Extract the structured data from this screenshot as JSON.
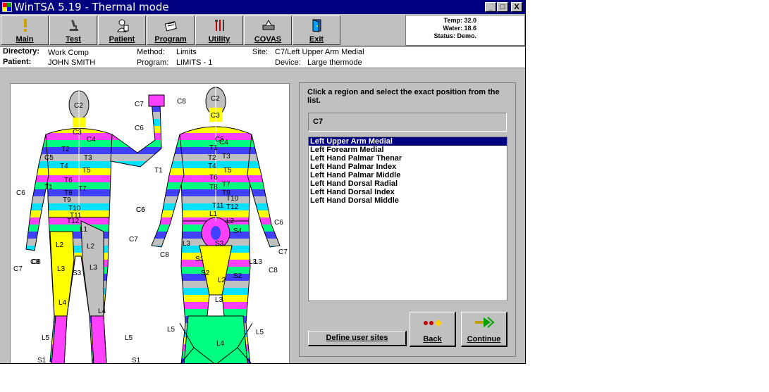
{
  "window": {
    "title": "WinTSA 5.19 - Thermal mode",
    "min": "_",
    "max": "□",
    "close": "X"
  },
  "toolbar": [
    {
      "label": "Main",
      "icon": "exclamation-icon"
    },
    {
      "label": "Test",
      "icon": "microscope-icon"
    },
    {
      "label": "Patient",
      "icon": "patient-icon"
    },
    {
      "label": "Program",
      "icon": "program-icon"
    },
    {
      "label": "Utility",
      "icon": "tools-icon"
    },
    {
      "label": "COVAS",
      "icon": "covas-icon"
    },
    {
      "label": "Exit",
      "icon": "exit-door-icon"
    }
  ],
  "status": {
    "temp": "Temp: 32.0",
    "water": "Water: 18.6",
    "state": "Status: Demo."
  },
  "info": {
    "directory_label": "Directory:",
    "directory": "Work Comp",
    "patient_label": "Patient:",
    "patient": "JOHN SMITH",
    "method_label": "Method:",
    "method": "Limits",
    "program_label": "Program:",
    "program": "LIMITS - 1",
    "site_label": "Site:",
    "site": "C7/Left Upper Arm Medial",
    "device_label": "Device:",
    "device": "Large thermode"
  },
  "panel": {
    "instruction": "Click a region and select the exact position from the list.",
    "selected": "C7",
    "items": [
      "Left Upper Arm Medial",
      "Left Forearm Medial",
      "Left Hand Palmar Thenar",
      "Left Hand Palmar Index",
      "Left Hand Palmar Middle",
      "Left Hand Dorsal Radial",
      "Left Hand Dorsal Index",
      "Left Hand Dorsal Middle"
    ],
    "define_label": "Define user sites",
    "back_label": "Back",
    "continue_label": "Continue"
  },
  "map_labels": {
    "front": [
      "C2",
      "C3",
      "C4",
      "T2",
      "T3",
      "T4",
      "T5",
      "T6",
      "T7",
      "T8",
      "T9",
      "T10",
      "T11",
      "T12",
      "L1",
      "L2",
      "L2",
      "L3",
      "L3",
      "S3",
      "L4",
      "L4",
      "L5",
      "L5",
      "S1",
      "S1",
      "C5",
      "C6",
      "C7",
      "C8",
      "C6",
      "C7",
      "C8",
      "T1",
      "C8",
      "T1",
      "C6"
    ],
    "back": [
      "C2",
      "C3",
      "C4",
      "C5",
      "T1",
      "T2",
      "T3",
      "T4",
      "T5",
      "T6",
      "T7",
      "T8",
      "T9",
      "T10",
      "T11",
      "T12",
      "L1",
      "L2",
      "L3",
      "S4",
      "S3",
      "S1",
      "S2",
      "S2",
      "L2",
      "L3",
      "L3",
      "L3",
      "L4",
      "L5",
      "L5",
      "C6",
      "C7",
      "C8",
      "C6",
      "C7",
      "C8"
    ]
  }
}
